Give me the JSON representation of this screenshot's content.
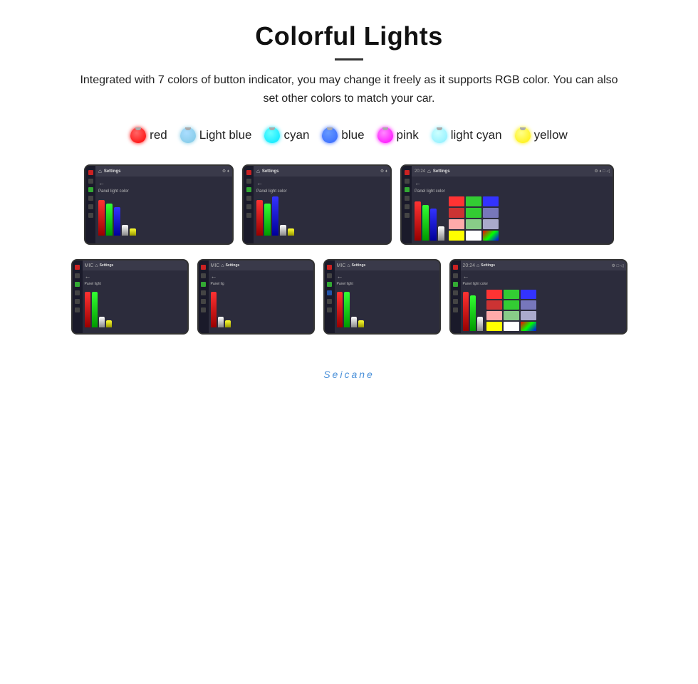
{
  "header": {
    "title": "Colorful Lights",
    "description": "Integrated with 7 colors of button indicator, you may change it freely as it supports RGB color. You can also set other colors to match your car."
  },
  "colors": [
    {
      "id": "red",
      "label": "red",
      "class": "bulb-red"
    },
    {
      "id": "lightblue",
      "label": "Light blue",
      "class": "bulb-lightblue"
    },
    {
      "id": "cyan",
      "label": "cyan",
      "class": "bulb-cyan"
    },
    {
      "id": "blue",
      "label": "blue",
      "class": "bulb-blue"
    },
    {
      "id": "pink",
      "label": "pink",
      "class": "bulb-pink"
    },
    {
      "id": "lightcyan",
      "label": "light cyan",
      "class": "bulb-lightcyan"
    },
    {
      "id": "yellow",
      "label": "yellow",
      "class": "bulb-yellow"
    }
  ],
  "screen": {
    "settings_label": "Settings",
    "panel_label": "Panel light color",
    "back_label": "←",
    "time": "20:24"
  },
  "watermark": {
    "text": "Seicane"
  },
  "swatches": {
    "row1": [
      "#ff0000",
      "#33cc33",
      "#3333ff"
    ],
    "row2": [
      "#cc3333",
      "#33cc33",
      "#888888"
    ],
    "row3": [
      "#ffaaaa",
      "#88ff88",
      "#aaaacc"
    ],
    "row4": [
      "#ffff00",
      "#ffffff",
      "#ff88ff"
    ]
  }
}
